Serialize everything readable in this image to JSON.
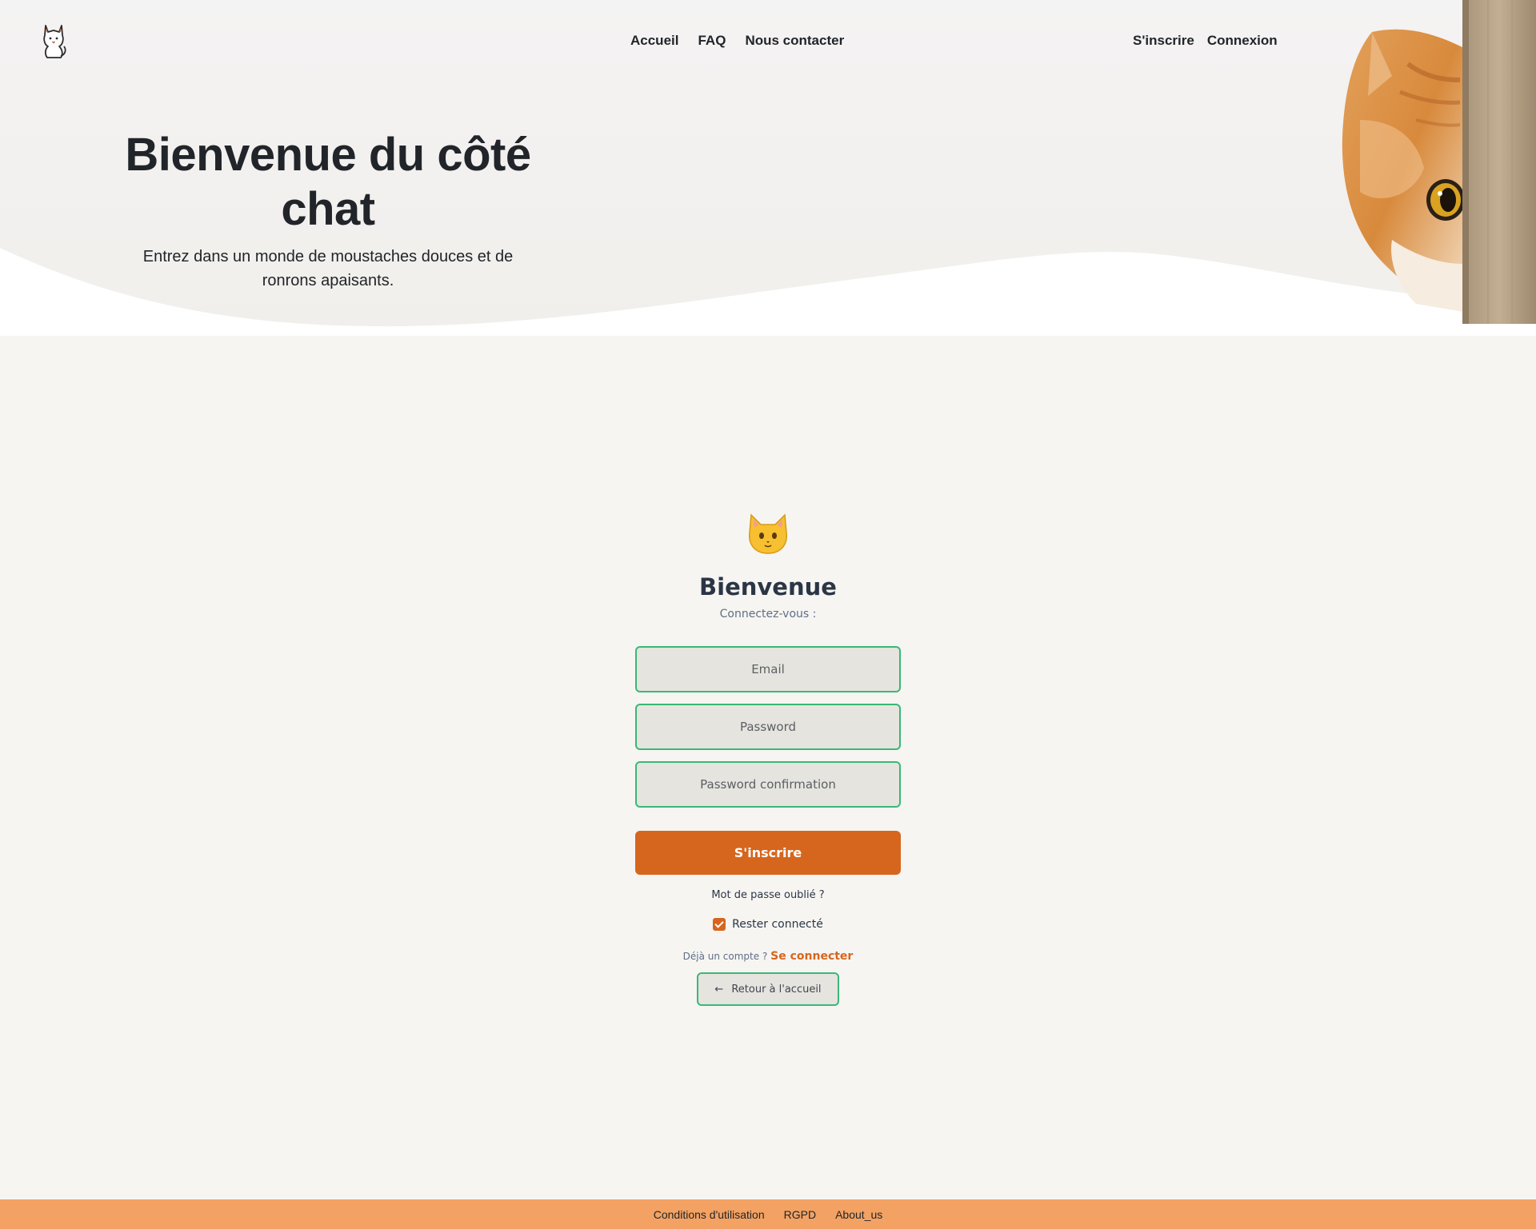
{
  "nav": {
    "logo_icon": "cat-outline-icon",
    "center_links": [
      "Accueil",
      "FAQ",
      "Nous contacter"
    ],
    "right_links": [
      "S'inscrire",
      "Connexion"
    ]
  },
  "hero": {
    "title": "Bienvenue du côté chat",
    "subtitle": "Entrez dans un monde de moustaches douces et de ronrons apaisants."
  },
  "auth": {
    "icon": "cat-face-emoji-icon",
    "title": "Bienvenue",
    "subtitle": "Connectez-vous :",
    "email_placeholder": "Email",
    "password_placeholder": "Password",
    "password_confirm_placeholder": "Password confirmation",
    "submit_label": "S'inscrire",
    "forgot_label": "Mot de passe oublié ?",
    "remember_label": "Rester connecté",
    "remember_checked": true,
    "already_text": "Déjà un compte ?",
    "login_label": "Se connecter",
    "back_arrow": "←",
    "back_label": "Retour à l'accueil"
  },
  "footer": {
    "links": [
      "Conditions d'utilisation",
      "RGPD",
      "About_us"
    ]
  },
  "colors": {
    "accent": "#d6661e",
    "field_border": "#3ab878",
    "footer_bg": "#f3a263",
    "page_bg": "#f6f5f2"
  }
}
